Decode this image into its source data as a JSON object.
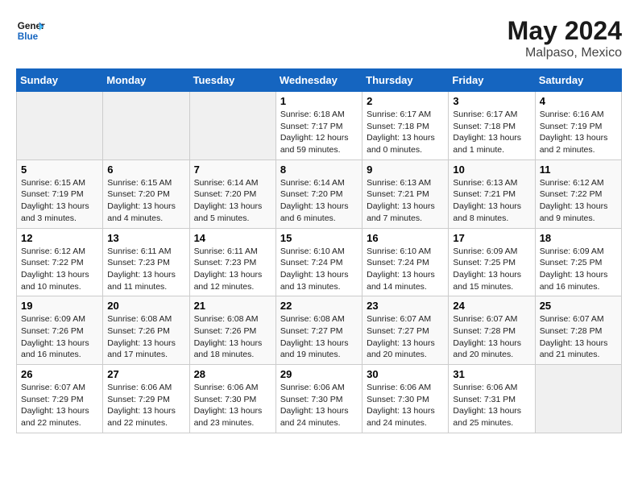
{
  "header": {
    "logo_general": "General",
    "logo_blue": "Blue",
    "title": "May 2024",
    "subtitle": "Malpaso, Mexico"
  },
  "days_of_week": [
    "Sunday",
    "Monday",
    "Tuesday",
    "Wednesday",
    "Thursday",
    "Friday",
    "Saturday"
  ],
  "weeks": [
    [
      {
        "day": "",
        "sunrise": "",
        "sunset": "",
        "daylight": ""
      },
      {
        "day": "",
        "sunrise": "",
        "sunset": "",
        "daylight": ""
      },
      {
        "day": "",
        "sunrise": "",
        "sunset": "",
        "daylight": ""
      },
      {
        "day": "1",
        "sunrise": "Sunrise: 6:18 AM",
        "sunset": "Sunset: 7:17 PM",
        "daylight": "Daylight: 12 hours and 59 minutes."
      },
      {
        "day": "2",
        "sunrise": "Sunrise: 6:17 AM",
        "sunset": "Sunset: 7:18 PM",
        "daylight": "Daylight: 13 hours and 0 minutes."
      },
      {
        "day": "3",
        "sunrise": "Sunrise: 6:17 AM",
        "sunset": "Sunset: 7:18 PM",
        "daylight": "Daylight: 13 hours and 1 minute."
      },
      {
        "day": "4",
        "sunrise": "Sunrise: 6:16 AM",
        "sunset": "Sunset: 7:19 PM",
        "daylight": "Daylight: 13 hours and 2 minutes."
      }
    ],
    [
      {
        "day": "5",
        "sunrise": "Sunrise: 6:15 AM",
        "sunset": "Sunset: 7:19 PM",
        "daylight": "Daylight: 13 hours and 3 minutes."
      },
      {
        "day": "6",
        "sunrise": "Sunrise: 6:15 AM",
        "sunset": "Sunset: 7:20 PM",
        "daylight": "Daylight: 13 hours and 4 minutes."
      },
      {
        "day": "7",
        "sunrise": "Sunrise: 6:14 AM",
        "sunset": "Sunset: 7:20 PM",
        "daylight": "Daylight: 13 hours and 5 minutes."
      },
      {
        "day": "8",
        "sunrise": "Sunrise: 6:14 AM",
        "sunset": "Sunset: 7:20 PM",
        "daylight": "Daylight: 13 hours and 6 minutes."
      },
      {
        "day": "9",
        "sunrise": "Sunrise: 6:13 AM",
        "sunset": "Sunset: 7:21 PM",
        "daylight": "Daylight: 13 hours and 7 minutes."
      },
      {
        "day": "10",
        "sunrise": "Sunrise: 6:13 AM",
        "sunset": "Sunset: 7:21 PM",
        "daylight": "Daylight: 13 hours and 8 minutes."
      },
      {
        "day": "11",
        "sunrise": "Sunrise: 6:12 AM",
        "sunset": "Sunset: 7:22 PM",
        "daylight": "Daylight: 13 hours and 9 minutes."
      }
    ],
    [
      {
        "day": "12",
        "sunrise": "Sunrise: 6:12 AM",
        "sunset": "Sunset: 7:22 PM",
        "daylight": "Daylight: 13 hours and 10 minutes."
      },
      {
        "day": "13",
        "sunrise": "Sunrise: 6:11 AM",
        "sunset": "Sunset: 7:23 PM",
        "daylight": "Daylight: 13 hours and 11 minutes."
      },
      {
        "day": "14",
        "sunrise": "Sunrise: 6:11 AM",
        "sunset": "Sunset: 7:23 PM",
        "daylight": "Daylight: 13 hours and 12 minutes."
      },
      {
        "day": "15",
        "sunrise": "Sunrise: 6:10 AM",
        "sunset": "Sunset: 7:24 PM",
        "daylight": "Daylight: 13 hours and 13 minutes."
      },
      {
        "day": "16",
        "sunrise": "Sunrise: 6:10 AM",
        "sunset": "Sunset: 7:24 PM",
        "daylight": "Daylight: 13 hours and 14 minutes."
      },
      {
        "day": "17",
        "sunrise": "Sunrise: 6:09 AM",
        "sunset": "Sunset: 7:25 PM",
        "daylight": "Daylight: 13 hours and 15 minutes."
      },
      {
        "day": "18",
        "sunrise": "Sunrise: 6:09 AM",
        "sunset": "Sunset: 7:25 PM",
        "daylight": "Daylight: 13 hours and 16 minutes."
      }
    ],
    [
      {
        "day": "19",
        "sunrise": "Sunrise: 6:09 AM",
        "sunset": "Sunset: 7:26 PM",
        "daylight": "Daylight: 13 hours and 16 minutes."
      },
      {
        "day": "20",
        "sunrise": "Sunrise: 6:08 AM",
        "sunset": "Sunset: 7:26 PM",
        "daylight": "Daylight: 13 hours and 17 minutes."
      },
      {
        "day": "21",
        "sunrise": "Sunrise: 6:08 AM",
        "sunset": "Sunset: 7:26 PM",
        "daylight": "Daylight: 13 hours and 18 minutes."
      },
      {
        "day": "22",
        "sunrise": "Sunrise: 6:08 AM",
        "sunset": "Sunset: 7:27 PM",
        "daylight": "Daylight: 13 hours and 19 minutes."
      },
      {
        "day": "23",
        "sunrise": "Sunrise: 6:07 AM",
        "sunset": "Sunset: 7:27 PM",
        "daylight": "Daylight: 13 hours and 20 minutes."
      },
      {
        "day": "24",
        "sunrise": "Sunrise: 6:07 AM",
        "sunset": "Sunset: 7:28 PM",
        "daylight": "Daylight: 13 hours and 20 minutes."
      },
      {
        "day": "25",
        "sunrise": "Sunrise: 6:07 AM",
        "sunset": "Sunset: 7:28 PM",
        "daylight": "Daylight: 13 hours and 21 minutes."
      }
    ],
    [
      {
        "day": "26",
        "sunrise": "Sunrise: 6:07 AM",
        "sunset": "Sunset: 7:29 PM",
        "daylight": "Daylight: 13 hours and 22 minutes."
      },
      {
        "day": "27",
        "sunrise": "Sunrise: 6:06 AM",
        "sunset": "Sunset: 7:29 PM",
        "daylight": "Daylight: 13 hours and 22 minutes."
      },
      {
        "day": "28",
        "sunrise": "Sunrise: 6:06 AM",
        "sunset": "Sunset: 7:30 PM",
        "daylight": "Daylight: 13 hours and 23 minutes."
      },
      {
        "day": "29",
        "sunrise": "Sunrise: 6:06 AM",
        "sunset": "Sunset: 7:30 PM",
        "daylight": "Daylight: 13 hours and 24 minutes."
      },
      {
        "day": "30",
        "sunrise": "Sunrise: 6:06 AM",
        "sunset": "Sunset: 7:30 PM",
        "daylight": "Daylight: 13 hours and 24 minutes."
      },
      {
        "day": "31",
        "sunrise": "Sunrise: 6:06 AM",
        "sunset": "Sunset: 7:31 PM",
        "daylight": "Daylight: 13 hours and 25 minutes."
      },
      {
        "day": "",
        "sunrise": "",
        "sunset": "",
        "daylight": ""
      }
    ]
  ]
}
